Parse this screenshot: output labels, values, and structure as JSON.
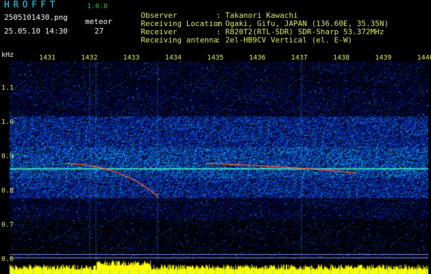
{
  "header": {
    "app_title": "HROFFT",
    "version": "1.0.0",
    "filename": "2505101430.png",
    "datetime": "25.05.10 14:30",
    "meteor_label": "meteor",
    "meteor_count": "27"
  },
  "info": [
    {
      "label": "Observer",
      "value": ": Takanori Kawachi"
    },
    {
      "label": "Receiving Location",
      "value": ": Ogaki, Gifu, JAPAN (136.60E, 35.35N)"
    },
    {
      "label": "Receiver",
      "value": ": R820T2(RTL-SDR) SDR-Sharp 53.372MHz"
    },
    {
      "label": "Receiving antenna",
      "value": ": 2el-HB9CV Vertical (el. E-W)"
    }
  ],
  "spectrogram": {
    "y_unit": "kHz",
    "y_ticks": [
      "1.1",
      "1.0",
      "0.9",
      "0.8",
      "0.7",
      "0.6"
    ],
    "y_values": [
      1.1,
      1.0,
      0.9,
      0.8,
      0.7,
      0.6
    ],
    "x_ticks": [
      "1431",
      "1432",
      "1433",
      "1434",
      "1435",
      "1436",
      "1437",
      "1438",
      "1439",
      "1440"
    ],
    "x_values": [
      1431,
      1432,
      1433,
      1434,
      1435,
      1436,
      1437,
      1438,
      1439,
      1440
    ],
    "carrier_khz": 0.865,
    "colors": {
      "background": "#000000",
      "noise_dark": "#000a6e",
      "noise_mid": "#0a3cd2",
      "noise_hi": "#00b4ff",
      "carrier": "#46e6c8",
      "meteor_trail": "#ff5a28",
      "signal_bar": "#ffff00",
      "tick_text": "#e8f070"
    }
  }
}
